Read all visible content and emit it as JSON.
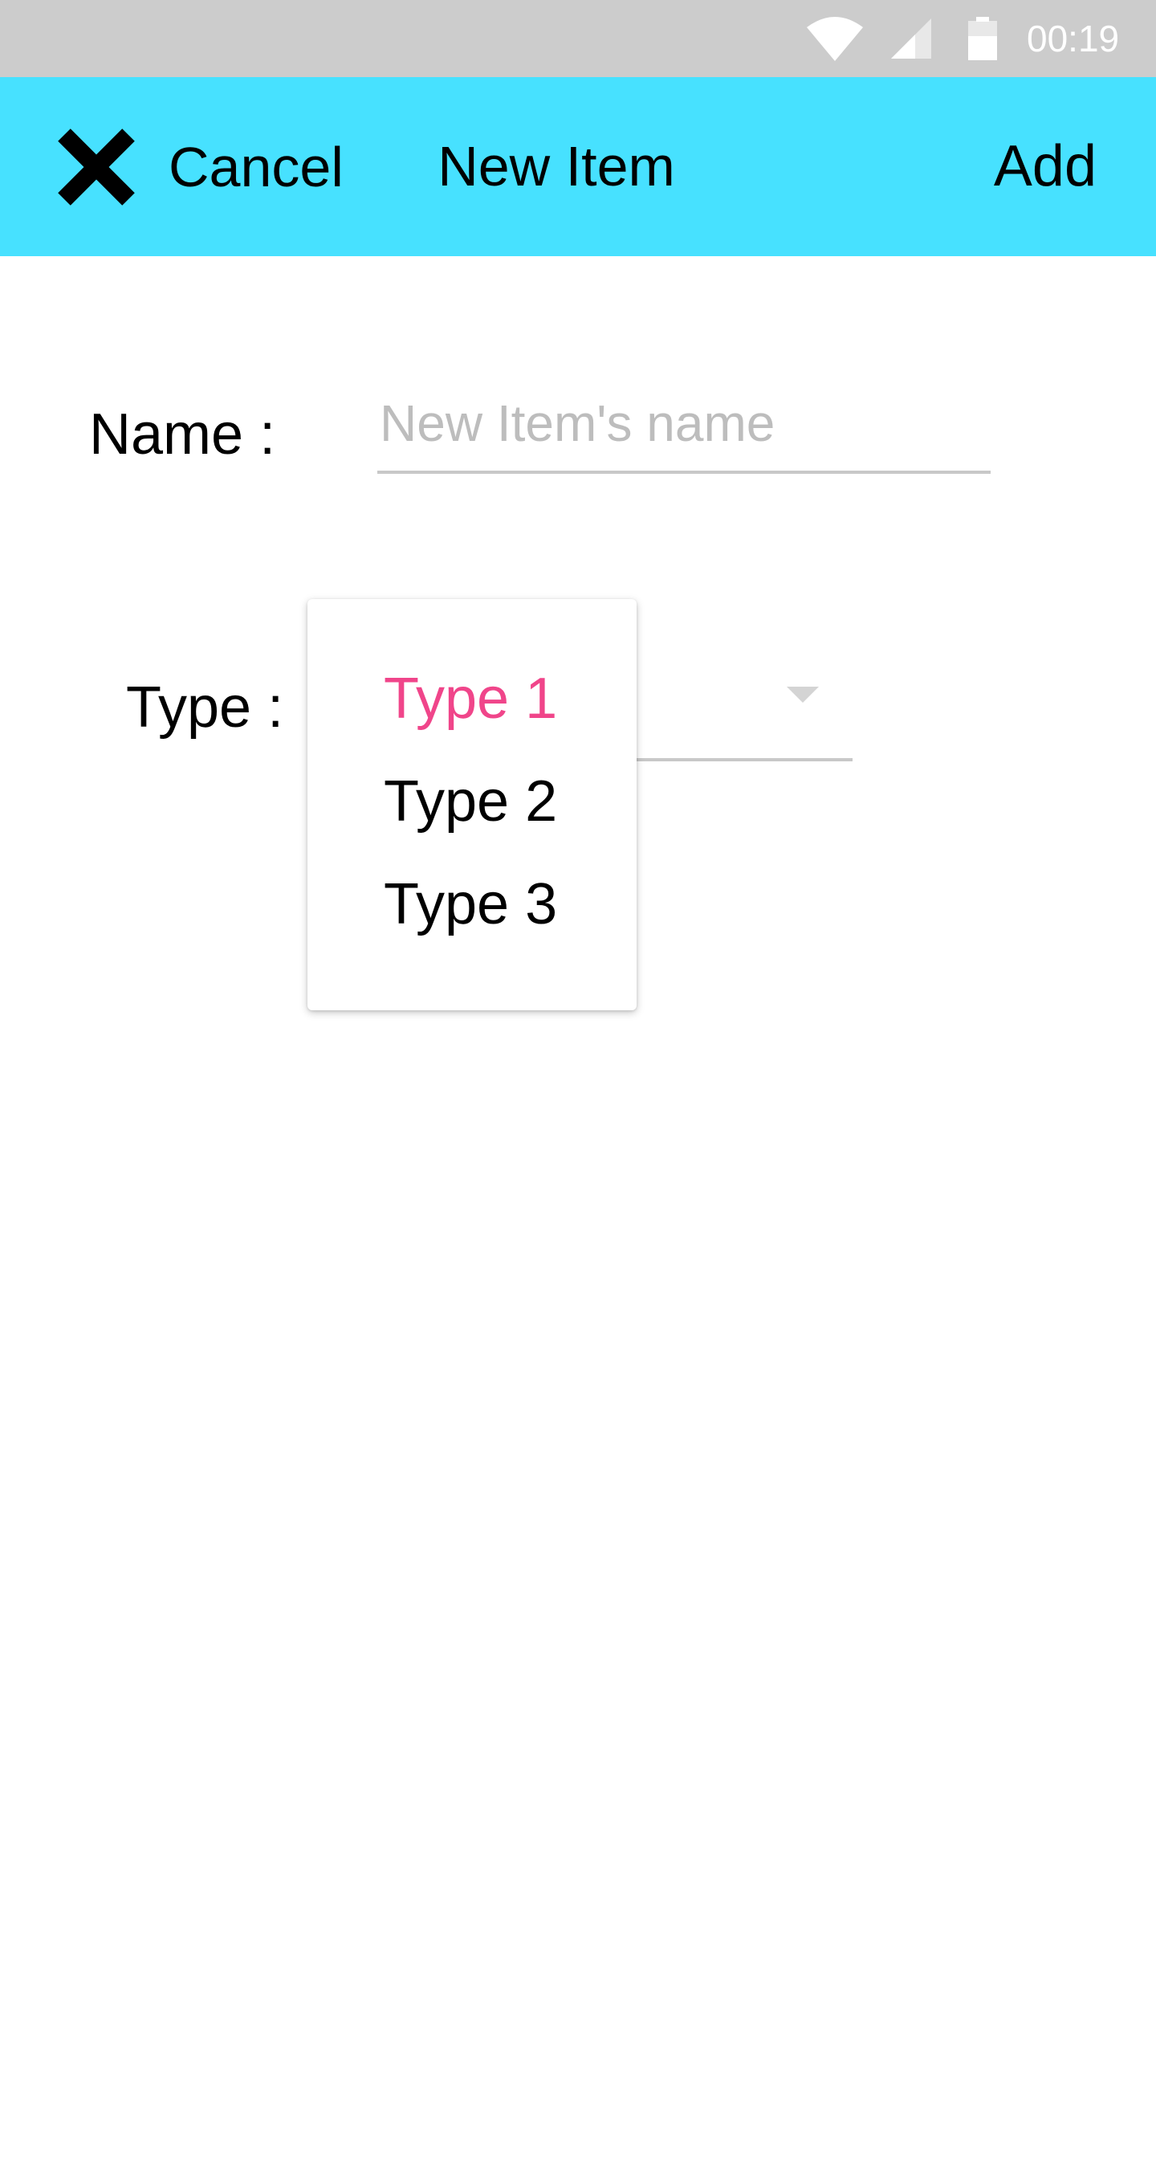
{
  "status_bar": {
    "time": "00:19",
    "icons": [
      "wifi-icon",
      "signal-icon",
      "battery-icon"
    ]
  },
  "app_bar": {
    "cancel_label": "Cancel",
    "title": "New Item",
    "add_label": "Add",
    "background_color": "#47e1ff",
    "close_icon": "close-icon"
  },
  "form": {
    "name_label": "Name :",
    "name_value": "",
    "name_placeholder": "New Item's name",
    "type_label": "Type :",
    "type_options": [
      "Type 1",
      "Type 2",
      "Type 3"
    ],
    "type_selected": "Type 1",
    "selected_color": "#f0458a"
  }
}
